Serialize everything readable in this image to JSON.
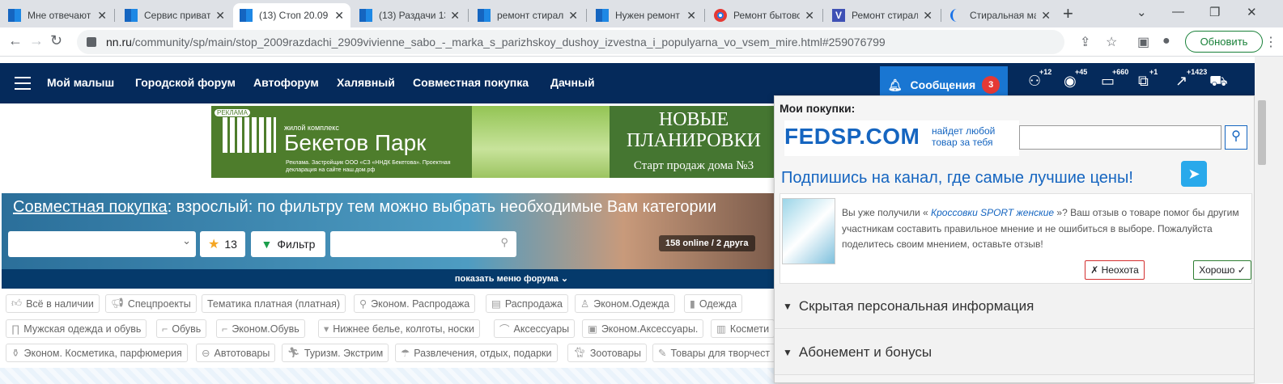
{
  "browser": {
    "tabs": [
      {
        "title": "Мне отвечают",
        "icon": "win",
        "active": false
      },
      {
        "title": "Сервис приват",
        "icon": "win",
        "active": false
      },
      {
        "title": "(13) Стоп 20.09",
        "icon": "win",
        "active": true
      },
      {
        "title": "(13) Раздачи 13",
        "icon": "win",
        "active": false
      },
      {
        "title": "ремонт стирал",
        "icon": "win",
        "active": false
      },
      {
        "title": "Нужен ремонт",
        "icon": "win",
        "active": false
      },
      {
        "title": "Ремонт бытово",
        "icon": "chrome",
        "active": false
      },
      {
        "title": "Ремонт стирал",
        "icon": "v",
        "active": false
      },
      {
        "title": "Стиральная ма",
        "icon": "moon",
        "active": false
      }
    ],
    "url_domain": "nn.ru",
    "url_path": "/community/sp/main/stop_2009razdachi_2909vivienne_sabo_-_marka_s_parizhskoy_dushoy_izvestna_i_populyarna_vo_vsem_mire.html#259076799",
    "update_label": "Обновить"
  },
  "site_nav": {
    "items": [
      "Мой малыш",
      "Городской форум",
      "Автофорум",
      "Халявный",
      "Совместная покупка",
      "Дачный"
    ],
    "messages_label": "Сообщения",
    "messages_count": "3",
    "counters": [
      "+12",
      "+45",
      "+660",
      "+1",
      "+1423"
    ]
  },
  "banner": {
    "ad_label": "РЕКЛАМА",
    "small_text": "жилой комплекс",
    "name": "Бекетов Парк",
    "declaration": "Реклама. Застройщик ООО «СЗ «ННДК Бекетова». Проектная декларация на сайте наш.дом.рф",
    "headline": "НОВЫЕ ПЛАНИРОВКИ",
    "sub": "Старт продаж дома №3"
  },
  "hero": {
    "title_link": "Совместная покупка",
    "title_rest": ": взрослый: по фильтру тем можно выбрать необходимые Вам категории",
    "star_count": "13",
    "filter_label": "Фильтр",
    "online": "158 online / 2 друга",
    "menu_toggle": "показать меню форума"
  },
  "categories": [
    [
      "Всё в наличии",
      "Спецпроекты",
      "Тематика платная (платная)",
      "Эконом. Распродажа",
      "Распродажа",
      "Эконом.Одежда",
      "Одежда"
    ],
    [
      "Мужская одежда и обувь",
      "Обувь",
      "Эконом.Обувь",
      "Нижнее белье, колготы, носки",
      "Аксессуары",
      "Эконом.Аксессуары.",
      "Космети"
    ],
    [
      "Эконом. Косметика, парфюмерия",
      "Автотовары",
      "Туризм. Экстрим",
      "Развлечения, отдых, подарки",
      "Зоотовары",
      "Товары для творчест"
    ]
  ],
  "popup": {
    "title": "Мои покупки:",
    "logo": "FEDSP.COM",
    "tagline_1": "найдет любой",
    "tagline_2": "товар за тебя",
    "telegram_text": "Подпишись на канал, где самые лучшие цены!",
    "review_pre": "Вы уже получили « ",
    "review_item": "Кроссовки SPORT женские",
    "review_post": " »? Ваш отзыв о товаре помог бы другим участникам составить правильное мнение и не ошибиться в выборе. Пожалуйста поделитесь своим мнением, оставьте отзыв!",
    "btn_no": "✗ Неохота",
    "btn_yes": "Хорошо ✓",
    "section_1": "Скрытая персональная информация",
    "section_2": "Абонемент и бонусы"
  }
}
